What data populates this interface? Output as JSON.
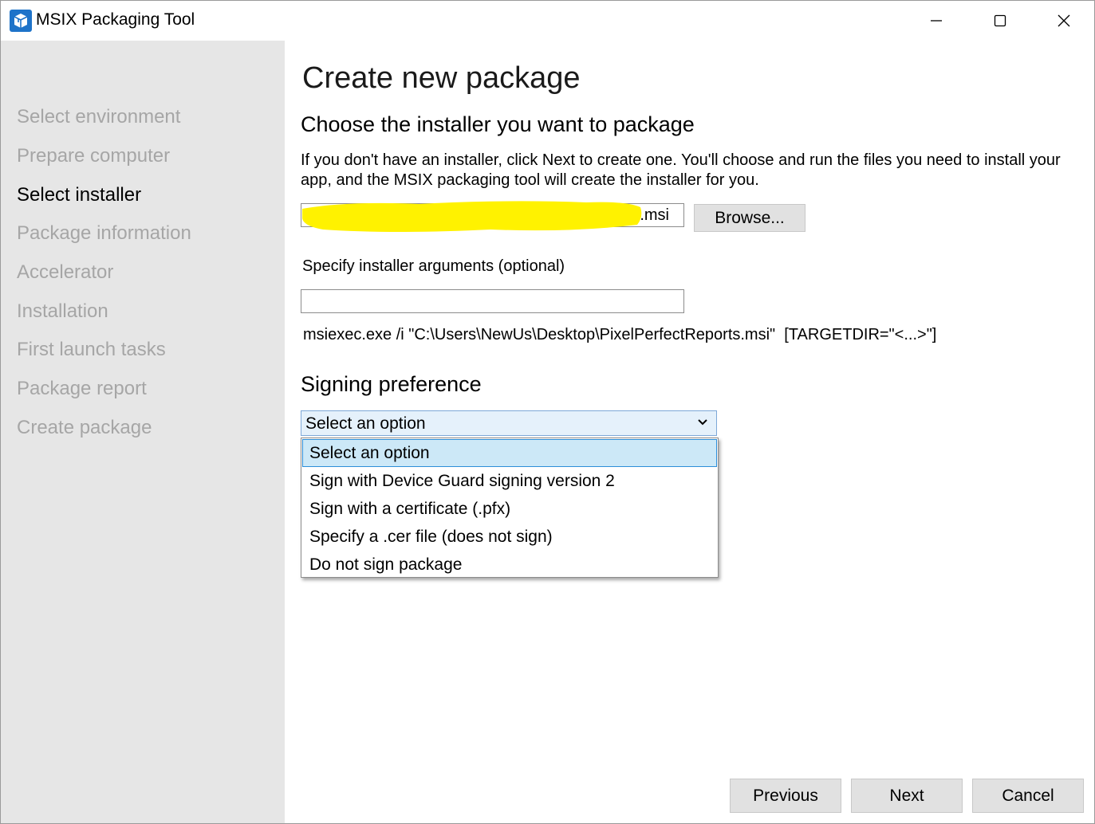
{
  "titlebar": {
    "title": "MSIX Packaging Tool",
    "icon": "msix-package-icon"
  },
  "sidebar": {
    "steps": [
      {
        "label": "Select environment",
        "active": false
      },
      {
        "label": "Prepare computer",
        "active": false
      },
      {
        "label": "Select installer",
        "active": true
      },
      {
        "label": "Package information",
        "active": false
      },
      {
        "label": "Accelerator",
        "active": false
      },
      {
        "label": "Installation",
        "active": false
      },
      {
        "label": "First launch tasks",
        "active": false
      },
      {
        "label": "Package report",
        "active": false
      },
      {
        "label": "Create package",
        "active": false
      }
    ]
  },
  "main": {
    "page_title": "Create new package",
    "installer_heading": "Choose the installer you want to package",
    "description": "If you don't have an installer, click Next to create one. You'll choose and run the files you need to install your app, and the MSIX packaging tool will create the installer for you.",
    "installer_path_visible": "s.msi",
    "browse_label": "Browse...",
    "args_label": "Specify installer arguments (optional)",
    "args_value": "",
    "command_line": "msiexec.exe /i \"C:\\Users\\NewUs\\Desktop\\PixelPerfectReports.msi\"  [TARGETDIR=\"<...>\"]",
    "signing_heading": "Signing preference",
    "signing_select": {
      "value": "Select an option",
      "options": [
        "Select an option",
        "Sign with Device Guard signing version 2",
        "Sign with a certificate (.pfx)",
        "Specify a .cer file (does not sign)",
        "Do not sign package"
      ]
    }
  },
  "footer": {
    "previous_label": "Previous",
    "next_label": "Next",
    "cancel_label": "Cancel"
  },
  "colors": {
    "sidebar_bg": "#e6e6e6",
    "inactive_step": "#a6a6a6",
    "highlight": "#fff200",
    "select_bg": "#e5f1fb",
    "option_selected_bg": "#cce8f7",
    "option_selected_border": "#2c8ed8",
    "button_bg": "#e1e1e1"
  }
}
